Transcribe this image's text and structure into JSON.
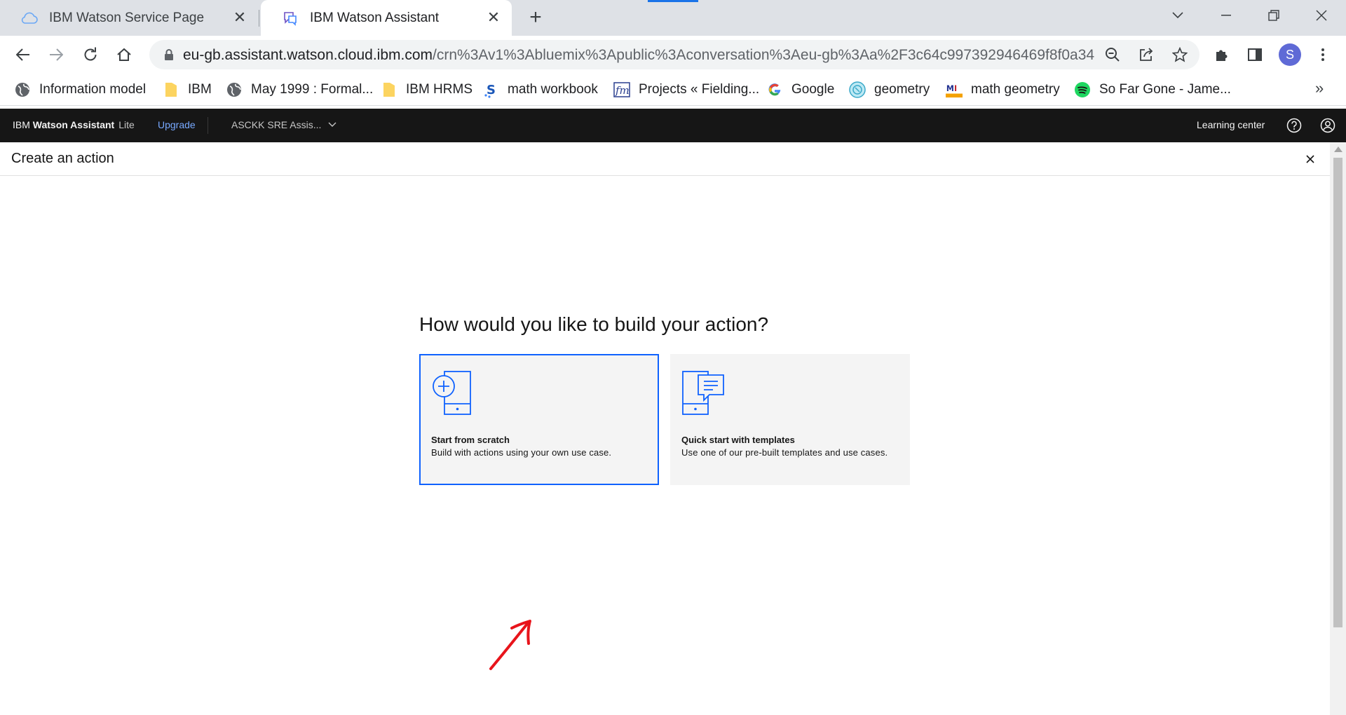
{
  "browser": {
    "tabs": [
      {
        "title": "IBM Watson Service Page",
        "icon": "cloud-icon",
        "active": false
      },
      {
        "title": "IBM Watson Assistant",
        "icon": "chat-icon",
        "active": true
      }
    ],
    "new_tab_label": "+",
    "url_host": "eu-gb.assistant.watson.cloud.ibm.com",
    "url_path": "/crn%3Av1%3Abluemix%3Apublic%3Aconversation%3Aeu-gb%3Aa%2F3c64c997392946469f8f0a34...",
    "profile_initial": "S",
    "bookmarks": [
      {
        "label": "Information model",
        "icon": "globe-icon"
      },
      {
        "label": "IBM",
        "icon": "folder-icon"
      },
      {
        "label": "May 1999 : Formal...",
        "icon": "globe-icon"
      },
      {
        "label": "IBM HRMS",
        "icon": "folder-icon"
      },
      {
        "label": "math workbook",
        "icon": "s-logo-icon"
      },
      {
        "label": "Projects « Fielding...",
        "icon": "fm-logo-icon"
      },
      {
        "label": "Google",
        "icon": "google-icon"
      },
      {
        "label": "geometry",
        "icon": "geometry-icon"
      },
      {
        "label": "math geometry",
        "icon": "math-logo-icon"
      },
      {
        "label": "So Far Gone - Jame...",
        "icon": "spotify-icon"
      }
    ],
    "bookmarks_more": "»"
  },
  "watson_header": {
    "brand_prefix": "IBM",
    "brand_name": "Watson Assistant",
    "plan": "Lite",
    "upgrade": "Upgrade",
    "assistant_name": "ASCKK SRE Assis...",
    "learning_center": "Learning center"
  },
  "panel": {
    "title": "Create an action"
  },
  "main": {
    "question": "How would you like to build your action?",
    "cards": [
      {
        "title": "Start from scratch",
        "description": "Build with actions using your own use case.",
        "selected": true
      },
      {
        "title": "Quick start with templates",
        "description": "Use one of our pre-built templates and use cases."
      }
    ]
  },
  "colors": {
    "ibm_blue": "#0f62fe",
    "header_bg": "#161616",
    "card_bg": "#f4f4f4",
    "annotation_red": "#e8141b"
  }
}
